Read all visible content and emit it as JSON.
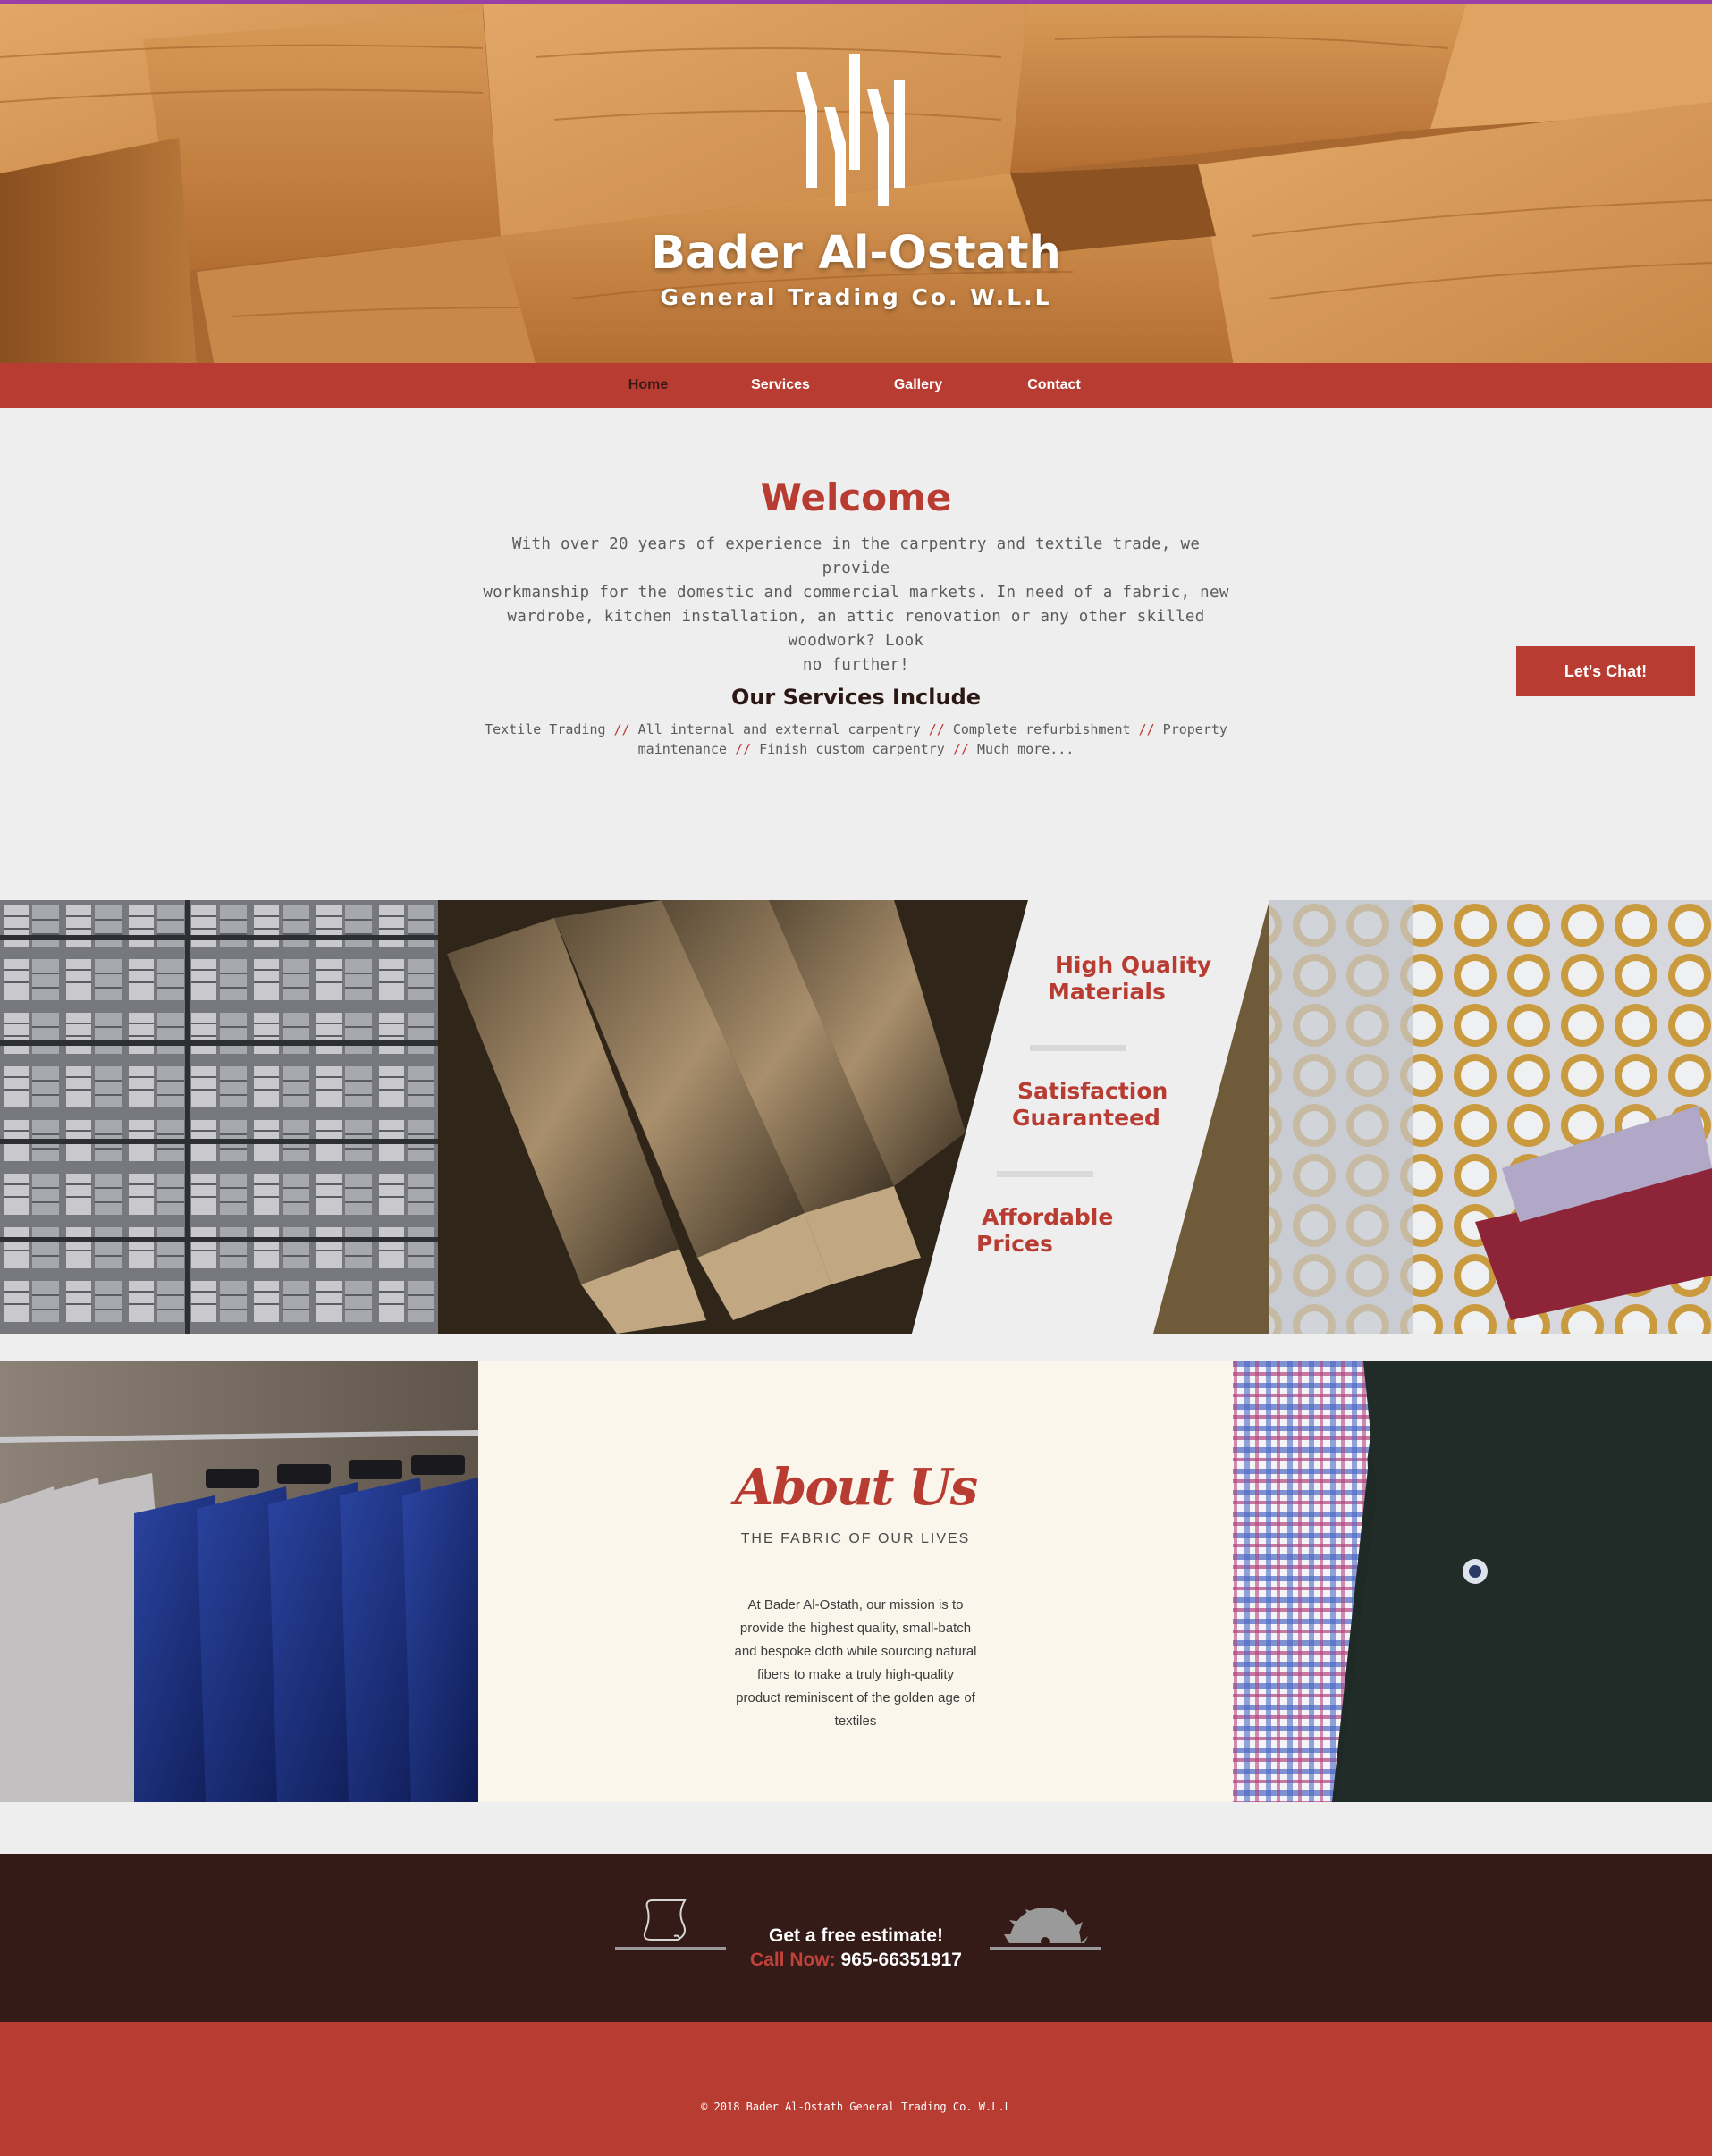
{
  "brand": {
    "name": "Bader Al-Ostath",
    "subtitle": "General Trading Co. W.L.L"
  },
  "nav": {
    "items": [
      {
        "label": "Home",
        "active": true
      },
      {
        "label": "Services",
        "active": false
      },
      {
        "label": "Gallery",
        "active": false
      },
      {
        "label": "Contact",
        "active": false
      }
    ]
  },
  "welcome": {
    "title": "Welcome",
    "lines": [
      "With over 20 years of experience in the carpentry and textile trade, we provide",
      "workmanship for the domestic and commercial markets. In need of a fabric, new",
      "wardrobe, kitchen installation, an attic renovation or any other skilled woodwork? Look",
      "no further!"
    ]
  },
  "services": {
    "title": "Our Services Include",
    "items": [
      "Textile Trading",
      "All internal and external carpentry",
      "Complete refurbishment",
      "Property maintenance",
      "Finish custom carpentry",
      "Much more..."
    ],
    "separator": "//"
  },
  "chat": {
    "label": "Let's Chat!"
  },
  "features": [
    {
      "line1": "High Quality",
      "line2": "Materials"
    },
    {
      "line1": "Satisfaction",
      "line2": "Guaranteed"
    },
    {
      "line1": "Affordable",
      "line2": "Prices"
    }
  ],
  "about": {
    "title": "About Us",
    "subtitle": "THE FABRIC OF OUR LIVES",
    "lines": [
      "At Bader Al-Ostath, our mission is to",
      "provide the highest quality, small-batch",
      "and bespoke cloth while sourcing natural",
      "fibers  to make a truly high-quality",
      "product reminiscent of the golden age of",
      "textiles"
    ]
  },
  "estimate": {
    "title": "Get a free estimate!",
    "call_label": "Call Now:",
    "phone": "965-66351917"
  },
  "footer": {
    "copyright": "© 2018 Bader Al-Ostath General Trading Co. W.L.L"
  },
  "colors": {
    "accent": "#b83c31",
    "dark": "#341b17",
    "about_bg": "#faf6ec",
    "page_bg": "#eeeeee"
  },
  "icons": [
    "logo-mark-icon",
    "scroll-icon",
    "saw-blade-icon"
  ]
}
